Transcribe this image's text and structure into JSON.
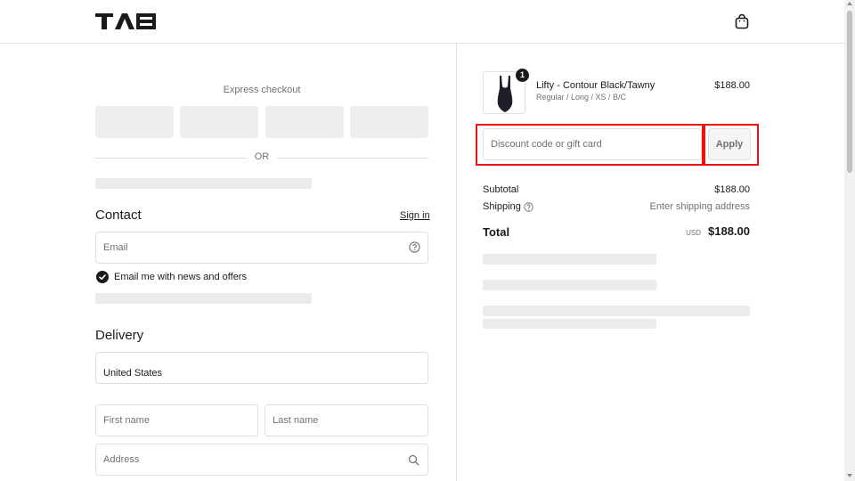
{
  "brand": {
    "logo_text": "TAB"
  },
  "header": {
    "cart_icon": "shopping-bag-icon"
  },
  "express": {
    "label": "Express checkout",
    "or_label": "OR"
  },
  "contact": {
    "title": "Contact",
    "signin_label": "Sign in",
    "email_placeholder": "Email",
    "newsletter_label": "Email me with news and offers",
    "newsletter_checked": true
  },
  "delivery": {
    "title": "Delivery",
    "country_value": "United States",
    "first_name_placeholder": "First name",
    "last_name_placeholder": "Last name",
    "address_placeholder": "Address"
  },
  "order": {
    "product": {
      "name": "Lifty - Contour Black/Tawny",
      "variant": "Regular / Long / XS / B/C",
      "price": "$188.00",
      "quantity": "1"
    },
    "discount_placeholder": "Discount code or gift card",
    "apply_label": "Apply",
    "subtotal_label": "Subtotal",
    "subtotal_value": "$188.00",
    "shipping_label": "Shipping",
    "shipping_value": "Enter shipping address",
    "total_label": "Total",
    "currency": "USD",
    "total_value": "$188.00"
  },
  "colors": {
    "highlight": "#ee1111",
    "skeleton": "#ebebeb",
    "text": "#1a1a1a",
    "muted": "#707070"
  }
}
